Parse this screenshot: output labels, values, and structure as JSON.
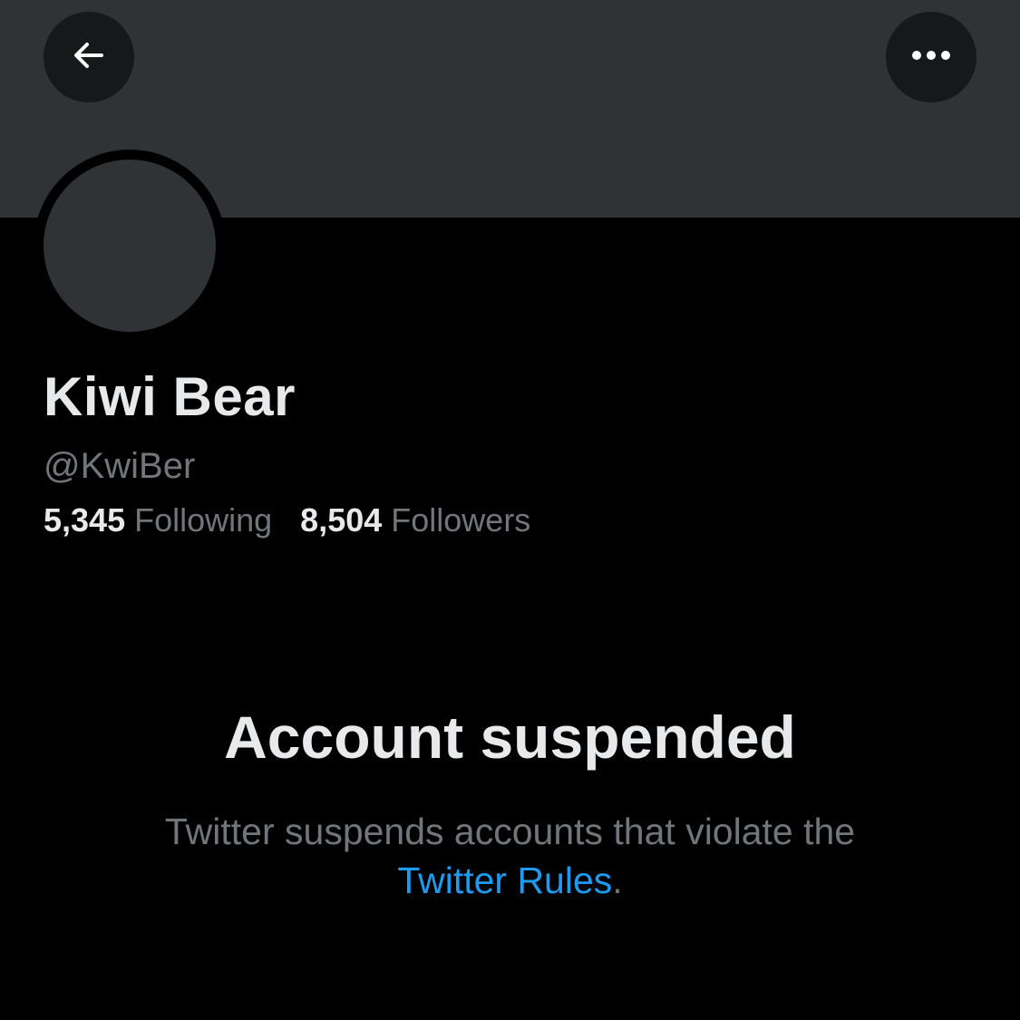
{
  "profile": {
    "display_name": "Kiwi Bear",
    "handle": "@KwiBer",
    "following_count": "5,345",
    "following_label": "Following",
    "followers_count": "8,504",
    "followers_label": "Followers"
  },
  "icons": {
    "back": "arrow-left-icon",
    "more": "more-horizontal-icon"
  },
  "notice": {
    "title": "Account suspended",
    "description_line1": "Twitter suspends accounts that violate the",
    "link_text": "Twitter Rules",
    "trailing": "."
  },
  "colors": {
    "background": "#000000",
    "banner": "#2f3336",
    "primary_text": "#e7e9ea",
    "secondary_text": "#71767b",
    "link": "#1d9bf0"
  }
}
